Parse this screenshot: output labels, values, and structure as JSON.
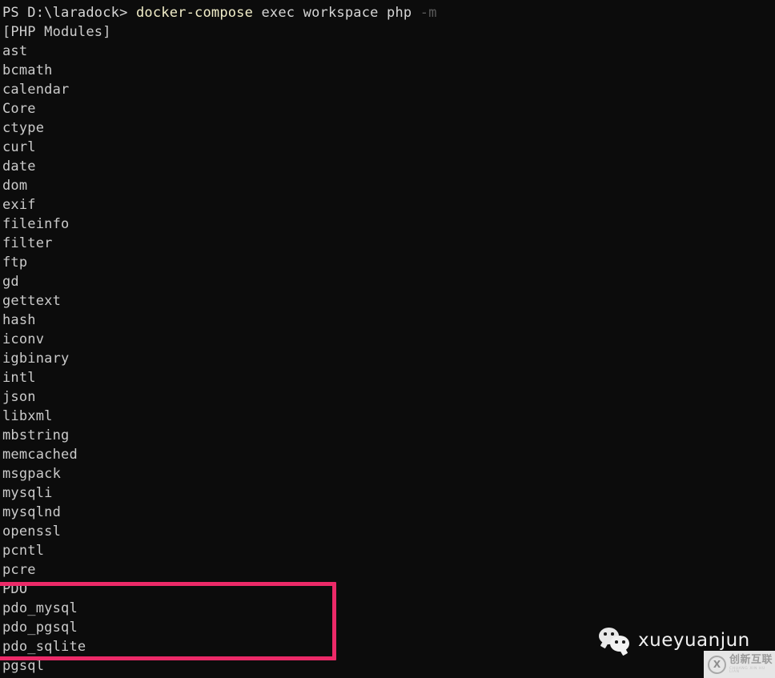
{
  "window": {
    "background_color": "#0c0c0c",
    "foreground_color": "#cccccc",
    "shell": "PowerShell"
  },
  "prompt_line": {
    "prompt": "PS D:\\laradock>",
    "command": "docker-compose",
    "args": "exec workspace php",
    "flag": "-m",
    "command_color": "#f2eec9",
    "flag_color": "#5a5a5a"
  },
  "output": {
    "header": "[PHP Modules]",
    "modules": [
      "ast",
      "bcmath",
      "calendar",
      "Core",
      "ctype",
      "curl",
      "date",
      "dom",
      "exif",
      "fileinfo",
      "filter",
      "ftp",
      "gd",
      "gettext",
      "hash",
      "iconv",
      "igbinary",
      "intl",
      "json",
      "libxml",
      "mbstring",
      "memcached",
      "msgpack",
      "mysqli",
      "mysqlnd",
      "openssl",
      "pcntl",
      "pcre",
      "PDO",
      "pdo_mysql",
      "pdo_pgsql",
      "pdo_sqlite",
      "pgsql"
    ]
  },
  "annotation": {
    "type": "rectangle-highlight",
    "color": "#ec2a68",
    "border_width_px": 5,
    "highlighted_modules": [
      "PDO",
      "pdo_mysql",
      "pdo_pgsql",
      "pdo_sqlite"
    ]
  },
  "watermark": {
    "icon": "wechat-icon",
    "label": "xueyuanjun"
  },
  "site_logo": {
    "icon": "circle-x-icon",
    "icon_glyph": "X",
    "title": "创新互联",
    "subtitle": "CHUANG XIN HU LIAN"
  }
}
